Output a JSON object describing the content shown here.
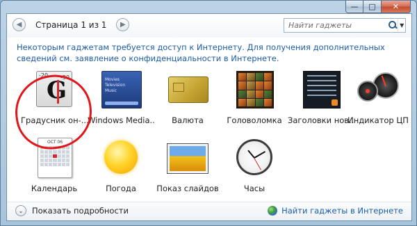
{
  "window": {
    "buttons": {
      "minimize": "—",
      "maximize": "□",
      "close": "✕"
    }
  },
  "toolbar": {
    "prev_icon": "◀",
    "next_icon": "▶",
    "page_label": "Страница 1 из 1",
    "search_placeholder": "Найти гаджеты",
    "dropdown_icon": "▼"
  },
  "info_text": "Некоторым гаджетам требуется доступ к Интернету. Для получения дополнительных сведений см. заявление о конфиденциальности в Интернете.",
  "gadgets": [
    {
      "label": "Градусник он-...",
      "icon": "thermometer-icon",
      "thermo_top_left": "-20",
      "thermo_top_right": "-30"
    },
    {
      "label": "Windows Media...",
      "icon": "media-center-icon",
      "wmc_lines": [
        "Movies",
        "Television",
        "Music"
      ]
    },
    {
      "label": "Валюта",
      "icon": "currency-icon"
    },
    {
      "label": "Головоломка",
      "icon": "puzzle-icon"
    },
    {
      "label": "Заголовки нов...",
      "icon": "headlines-icon"
    },
    {
      "label": "Индикатор ЦП",
      "icon": "cpu-meter-icon"
    },
    {
      "label": "Календарь",
      "icon": "calendar-icon",
      "calendar_header": "OCT 06"
    },
    {
      "label": "Погода",
      "icon": "weather-icon"
    },
    {
      "label": "Показ слайдов",
      "icon": "slideshow-icon"
    },
    {
      "label": "Часы",
      "icon": "clock-icon"
    }
  ],
  "annotation": {
    "color": "#e0161b"
  },
  "footer": {
    "details_label": "Показать подробности",
    "details_icon": "⌄",
    "online_label": "Найти гаджеты в Интернете"
  },
  "colors": {
    "link": "#1c5cab",
    "close_button": "#c24a2e"
  }
}
